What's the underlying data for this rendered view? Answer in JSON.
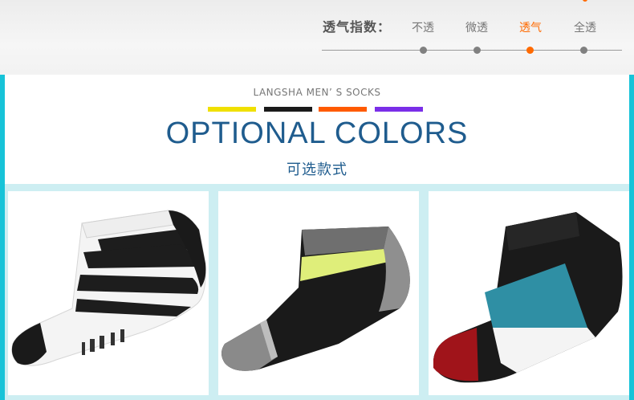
{
  "breathability": {
    "label": "透气指数：",
    "options": [
      "不透",
      "微透",
      "透气",
      "全透"
    ],
    "selected": "透气"
  },
  "section": {
    "brand": "LANGSHA MEN’ S SOCKS",
    "title": "OPTIONAL COLORS",
    "subtitle": "可选款式"
  },
  "swatches": [
    "#f0e000",
    "#1a1a1a",
    "#ff5a00",
    "#7a2ee8"
  ],
  "colors": {
    "accent": "#ff6a00",
    "frame": "#17c3d8",
    "heading": "#1f5c8e"
  },
  "products": [
    {
      "name": "white-black-stripe-sock-icon"
    },
    {
      "name": "black-yellow-gray-sock-icon"
    },
    {
      "name": "black-blue-white-red-sock-icon"
    }
  ]
}
